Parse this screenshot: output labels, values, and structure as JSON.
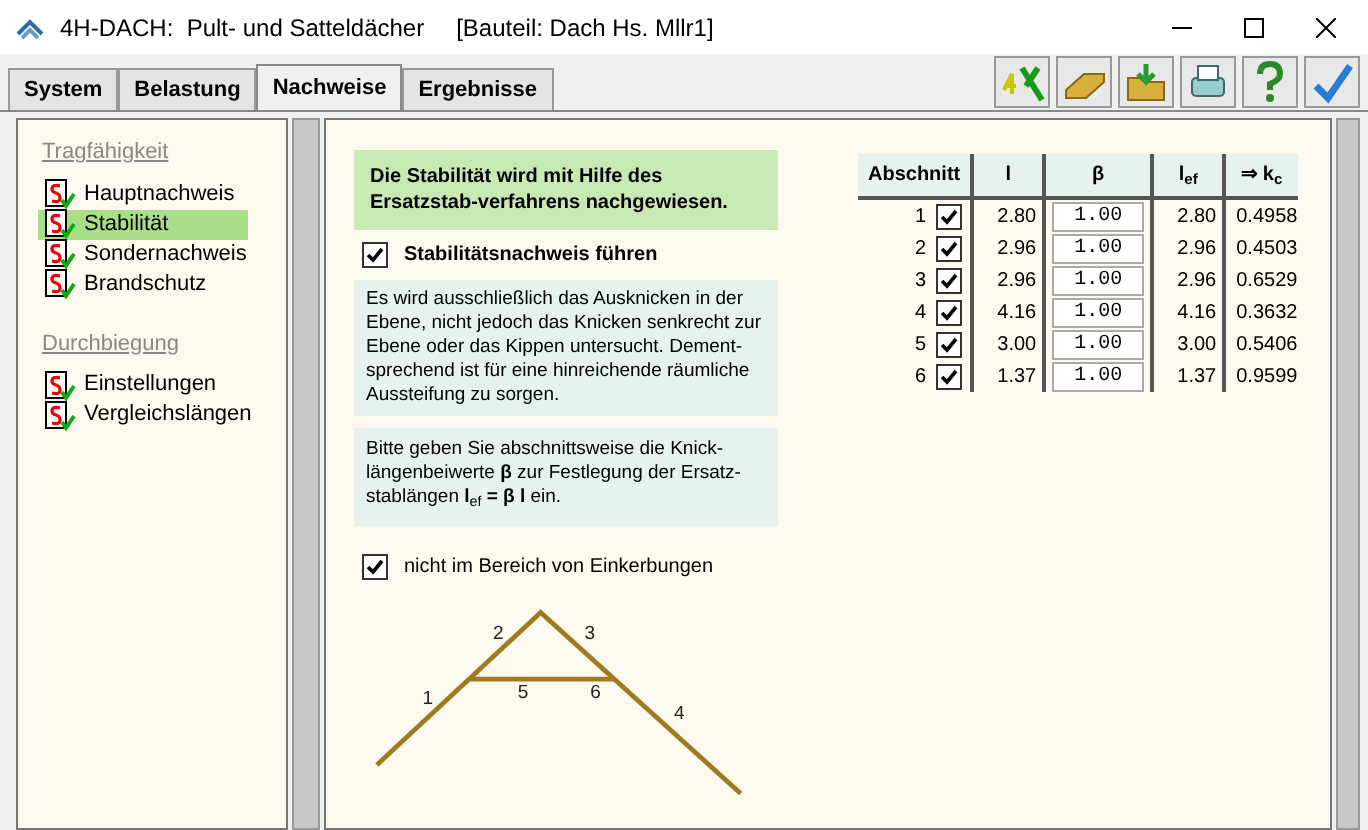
{
  "window": {
    "title": "4H-DACH:  Pult- und Satteldächer",
    "subtitle": "[Bauteil: Dach Hs. Mllr1]"
  },
  "tabs": [
    {
      "label": "System",
      "selected": false
    },
    {
      "label": "Belastung",
      "selected": false
    },
    {
      "label": "Nachweise",
      "selected": true
    },
    {
      "label": "Ergebnisse",
      "selected": false
    }
  ],
  "sidebar": {
    "groups": [
      {
        "title": "Tragfähigkeit",
        "items": [
          {
            "label": "Hauptnachweis",
            "selected": false
          },
          {
            "label": "Stabilität",
            "selected": true
          },
          {
            "label": "Sondernachweis",
            "selected": false
          },
          {
            "label": "Brandschutz",
            "selected": false
          }
        ]
      },
      {
        "title": "Durchbiegung",
        "items": [
          {
            "label": "Einstellungen",
            "selected": false
          },
          {
            "label": "Vergleichslängen",
            "selected": false
          }
        ]
      }
    ]
  },
  "info": "Die Stabilität wird mit Hilfe des Ersatzstab-verfahrens nachgewiesen.",
  "check_main": {
    "label": "Stabilitätsnachweis führen",
    "checked": true
  },
  "note_1": "Es wird ausschließlich das Ausknicken in der Ebene, nicht jedoch das Knicken senkrecht zur Ebene oder das Kippen untersucht. Dement-sprechend ist für eine hinreichende räumliche Aussteifung zu sorgen.",
  "note_2": "Bitte geben Sie abschnittsweise die Knick-längenbeiwerte **β** zur Festlegung der Ersatz-stablängen **l**$_{ef}$ **= β l** ein.",
  "check_notch": {
    "label": "nicht im Bereich von Einkerbungen",
    "checked": true
  },
  "table": {
    "columns": [
      "Abschnitt",
      "l",
      "β",
      "l$_{ef}$",
      "⇒ k$_{c}$"
    ],
    "rows": [
      {
        "n": "1",
        "checked": true,
        "l": "2.80",
        "beta": "1.00",
        "lef": "2.80",
        "kc": "0.4958"
      },
      {
        "n": "2",
        "checked": true,
        "l": "2.96",
        "beta": "1.00",
        "lef": "2.96",
        "kc": "0.4503"
      },
      {
        "n": "3",
        "checked": true,
        "l": "2.96",
        "beta": "1.00",
        "lef": "2.96",
        "kc": "0.6529"
      },
      {
        "n": "4",
        "checked": true,
        "l": "4.16",
        "beta": "1.00",
        "lef": "4.16",
        "kc": "0.3632"
      },
      {
        "n": "5",
        "checked": true,
        "l": "3.00",
        "beta": "1.00",
        "lef": "3.00",
        "kc": "0.5406"
      },
      {
        "n": "6",
        "checked": true,
        "l": "1.37",
        "beta": "1.00",
        "lef": "1.37",
        "kc": "0.9599"
      }
    ]
  },
  "diagram": {
    "labels": [
      "1",
      "2",
      "3",
      "4",
      "5",
      "6"
    ]
  }
}
